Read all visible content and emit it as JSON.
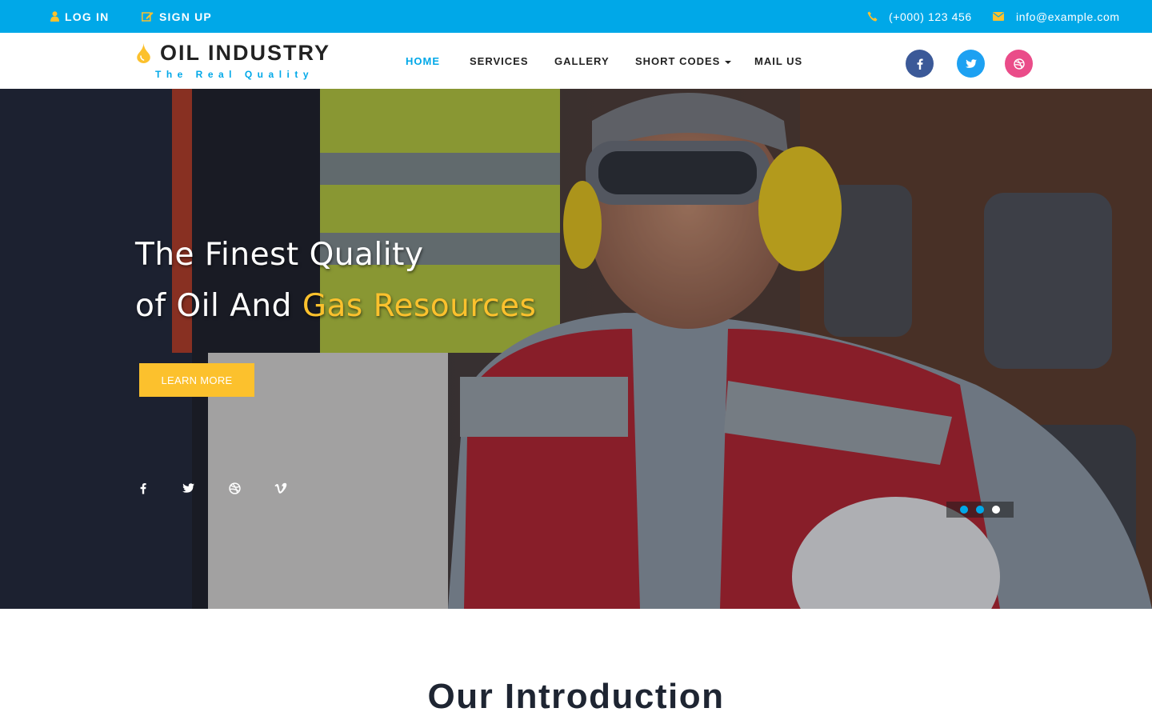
{
  "topbar": {
    "login": "LOG IN",
    "signup": "SIGN UP",
    "phone": "(+000) 123 456",
    "email": "info@example.com"
  },
  "logo": {
    "name": "OIL INDUSTRY",
    "tagline": "The Real Quality"
  },
  "nav": {
    "items": [
      {
        "label": "HOME",
        "active": true
      },
      {
        "label": "SERVICES"
      },
      {
        "label": "GALLERY"
      },
      {
        "label": "SHORT CODES",
        "dropdown": true
      },
      {
        "label": "MAIL US"
      }
    ]
  },
  "header_social": [
    "facebook-icon",
    "twitter-icon",
    "dribbble-icon"
  ],
  "hero": {
    "line1": "The Finest Quality",
    "line2_prefix": "of Oil And ",
    "line2_highlight": "Gas Resources",
    "button": "LEARN MORE",
    "social": [
      "facebook-icon",
      "twitter-icon",
      "dribbble-icon",
      "vimeo-icon"
    ],
    "slides": 3,
    "active_slide": 3
  },
  "section": {
    "title": "Our Introduction"
  },
  "colors": {
    "primary": "#00a8e8",
    "accent": "#fcc12d",
    "facebook": "#3b5998",
    "twitter": "#1da1f2",
    "dribbble": "#ea4c89"
  }
}
